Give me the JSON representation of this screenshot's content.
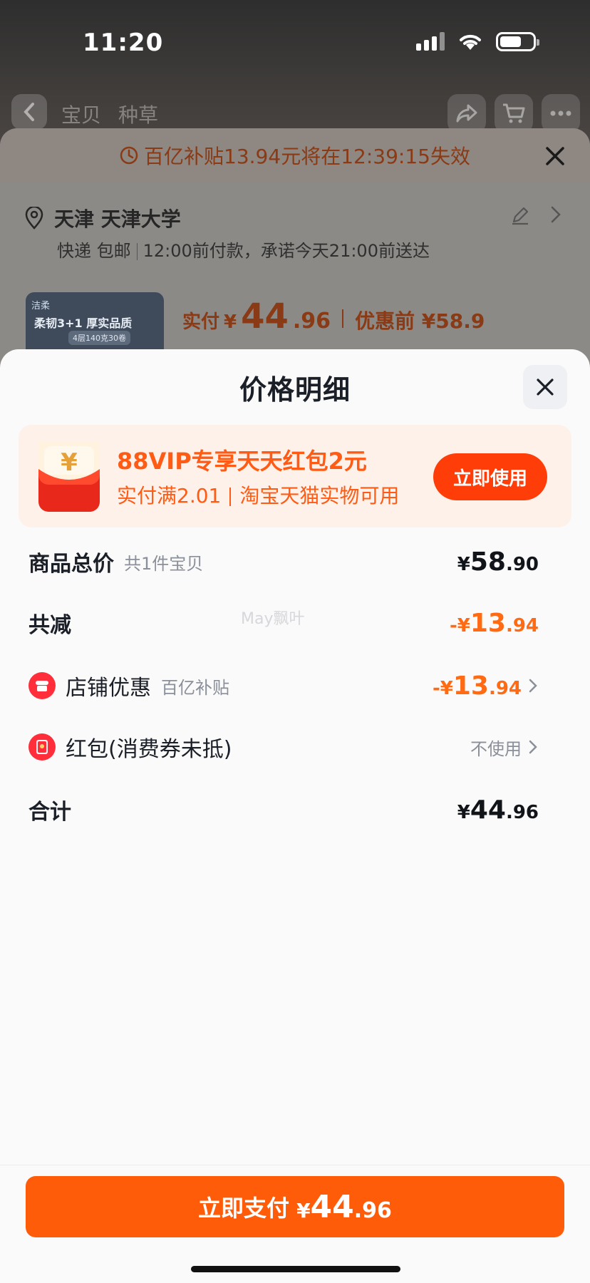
{
  "status_bar": {
    "time": "11:20"
  },
  "nav": {
    "tabs": [
      "宝贝",
      "种草"
    ]
  },
  "order_sheet": {
    "subsidy_notice": "百亿补贴13.94元将在12:39:15失效",
    "address_title": "天津 天津大学",
    "delivery_left": "快递 包邮",
    "delivery_right": "12:00前付款，承诺今天21:00前送达",
    "product_tag": "洁柔",
    "product_title": "柔韧3+1 厚实品质",
    "product_spec": "4层140克30卷",
    "price_label": "实付",
    "price_currency": "¥",
    "price_int": "44",
    "price_dec": ".96",
    "orig_price": "优惠前 ¥58.9"
  },
  "price_sheet": {
    "title": "价格明细",
    "vip_banner": {
      "title": "88VIP专享天天红包2元",
      "condition": "实付满2.01",
      "scope": "淘宝天猫实物可用",
      "button": "立即使用",
      "icon_glyph": "¥"
    },
    "rows": {
      "total_goods": {
        "label": "商品总价",
        "sub": "共1件宝贝",
        "cur": "¥",
        "int": "58",
        "dec": ".90"
      },
      "total_reduce": {
        "label": "共减",
        "cur": "-¥",
        "int": "13",
        "dec": ".94"
      },
      "store_discount": {
        "label": "店铺优惠",
        "sub": "百亿补贴",
        "cur": "-¥",
        "int": "13",
        "dec": ".94"
      },
      "red_packet": {
        "label": "红包(消费券未抵)",
        "value": "不使用"
      },
      "sum": {
        "label": "合计",
        "cur": "¥",
        "int": "44",
        "dec": ".96"
      }
    },
    "watermark": "May飘叶",
    "pay_button": {
      "label": "立即支付",
      "cur": "¥",
      "int": "44",
      "dec": ".96"
    }
  },
  "colors": {
    "accent": "#ff5c0a",
    "discount": "#ff6a13",
    "vip": "#ff5b14"
  }
}
